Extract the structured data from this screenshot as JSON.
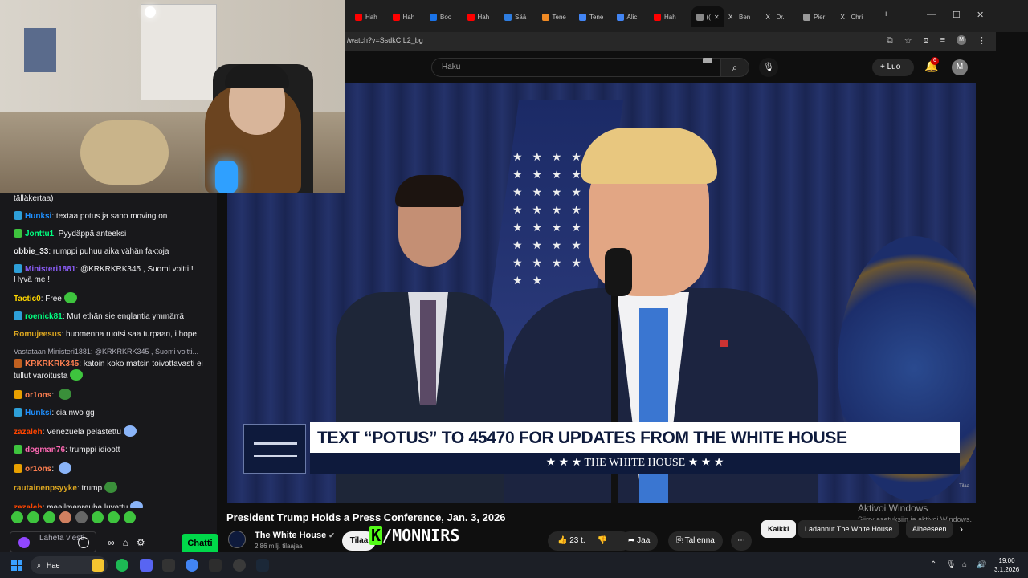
{
  "colors": {
    "youtube_red": "#cc0000",
    "kick_green": "#53fc18",
    "twitch_green": "#00d84a",
    "taskbar": "#1c1f26"
  },
  "browser": {
    "tabs": [
      {
        "label": "Hah",
        "icon": "youtube-icon"
      },
      {
        "label": "Hah",
        "icon": "youtube-icon"
      },
      {
        "label": "Boo",
        "icon": "bookmark-icon"
      },
      {
        "label": "Hah",
        "icon": "youtube-icon"
      },
      {
        "label": "Sää",
        "icon": "weather-icon"
      },
      {
        "label": "Tene",
        "icon": "tenor-icon"
      },
      {
        "label": "Tene",
        "icon": "google-icon"
      },
      {
        "label": "Alic",
        "icon": "google-icon"
      },
      {
        "label": "Hah",
        "icon": "youtube-icon"
      },
      {
        "label": "((",
        "icon": "speaker-icon",
        "active": true
      },
      {
        "label": "Ben",
        "icon": "x-icon"
      },
      {
        "label": "Dr.",
        "icon": "x-icon"
      },
      {
        "label": "Pier",
        "icon": "globe-icon"
      },
      {
        "label": "Chri",
        "icon": "x-icon"
      }
    ],
    "url": "/watch?v=SsdkCIL2_bg"
  },
  "youtube": {
    "search_placeholder": "Haku",
    "create_label": "Luo",
    "notif_count": "6",
    "avatar_letter": "M",
    "video_title": "President Trump Holds a Press Conference, Jan. 3, 2026",
    "channel_name": "The White House",
    "channel_subs": "2,86 milj. tilaajaa",
    "subscribe_label": "Tilaa",
    "like_count": "23 t.",
    "share_label": "Jaa",
    "save_label": "Tallenna",
    "chips": [
      "Kaikki",
      "Ladannut The White House",
      "Aiheeseen"
    ],
    "lower_third_top": "TEXT “POTUS” TO 45470 FOR UPDATES FROM THE WHITE HOUSE",
    "lower_third_bottom": "★ ★ ★  THE WHITE HOUSE  ★ ★ ★",
    "player_watermark": "Tilaa"
  },
  "kick_overlay": "/MONNIRS",
  "activate_windows": {
    "title": "Aktivoi Windows",
    "subtitle": "Siirry asetuksiin ja aktivoi Windows."
  },
  "chat": {
    "messages": [
      {
        "user": "",
        "text": "tälläkertaa)",
        "color": "#efeff1",
        "badge": ""
      },
      {
        "user": "Hunksi",
        "text": "textaa potus ja sano moving on",
        "color": "#1e90ff",
        "badge": "#2e9fd8"
      },
      {
        "user": "Jonttu1",
        "text": "Pyydäppä anteeksi",
        "color": "#00ff7f",
        "badge": "#3ec43e"
      },
      {
        "user": "obbie_33",
        "text": "rumppi puhuu aika vähän faktoja",
        "color": "#efeff1",
        "badge": ""
      },
      {
        "user": "Ministeri1881",
        "text": "@KRKRKRK345 , Suomi voitti ! Hyvä me !",
        "color": "#8a5cf6",
        "badge": "#2e9fd8"
      },
      {
        "user": "Tactic0",
        "text": "Free",
        "color": "#ffd700",
        "badge": "",
        "emote": "#3ec43e"
      },
      {
        "user": "roenick81",
        "text": "Mut ethän sie englantia ymmärrä",
        "color": "#00ff7f",
        "badge": "#2e9fd8"
      },
      {
        "user": "Romujeesus",
        "text": "huomenna ruotsi saa turpaan, i hope",
        "color": "#daa520",
        "badge": ""
      },
      {
        "user": "KRKRKRK345",
        "text": "katoin koko matsin toivottavasti ei tullut varoitusta",
        "color": "#ff7f50",
        "badge": "#c06020",
        "emote": "#3ec43e",
        "reply": "Vastataan Ministeri1881: @KRKRKRK345 , Suomi voitti..."
      },
      {
        "user": "or1ons",
        "text": "",
        "color": "#ff7f50",
        "badge": "#e8a000",
        "emote": "#3a8f3a"
      },
      {
        "user": "Hunksi",
        "text": "cia nwo gg",
        "color": "#1e90ff",
        "badge": "#2e9fd8"
      },
      {
        "user": "zazaleh",
        "text": "Venezuela pelastettu",
        "color": "#ff4500",
        "badge": "",
        "emote": "#8ab4f8"
      },
      {
        "user": "dogman76",
        "text": "trumppi idioott",
        "color": "#ff69b4",
        "badge": "#3ec43e"
      },
      {
        "user": "or1ons",
        "text": "",
        "color": "#ff7f50",
        "badge": "#e8a000",
        "emote": "#8ab4f8"
      },
      {
        "user": "rautainenpsyyke",
        "text": "trump",
        "color": "#daa520",
        "badge": "",
        "emote": "#3a8f3a"
      },
      {
        "user": "zazaleh",
        "text": "maailmanrauha luvattu",
        "color": "#ff4500",
        "badge": "",
        "emote": "#8ab4f8"
      }
    ],
    "input_placeholder": "Lähetä viesti",
    "chat_button": "Chatti"
  },
  "taskbar": {
    "search_label": "Hae",
    "time": "19.00",
    "date": "3.1.2026"
  }
}
